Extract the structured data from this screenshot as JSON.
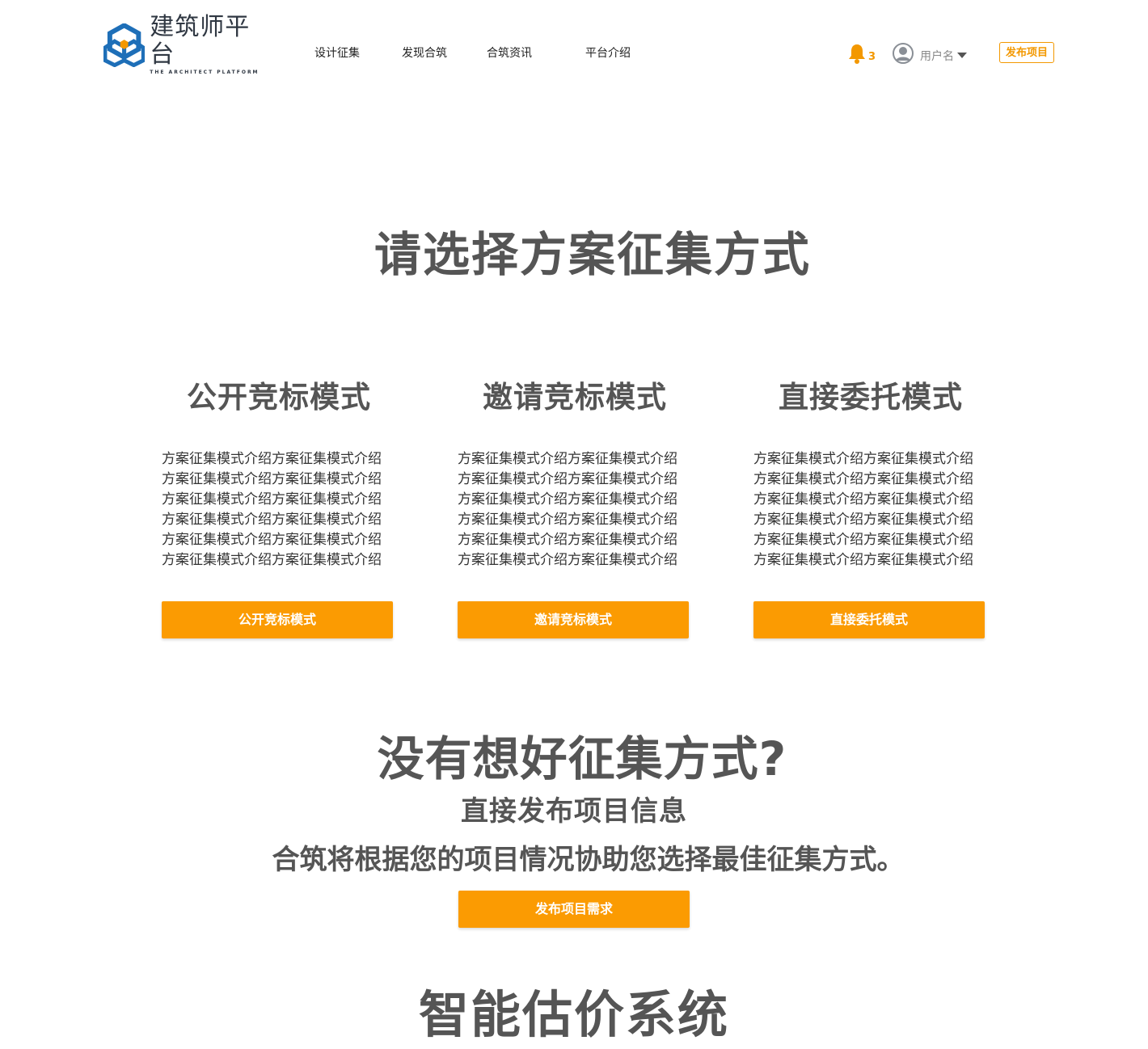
{
  "header": {
    "logo": {
      "text_cn": "建筑师平台",
      "text_en": "THE ARCHITECT PLATFORM"
    },
    "nav": [
      {
        "label": "设计征集"
      },
      {
        "label": "发现合筑"
      },
      {
        "label": "合筑资讯"
      },
      {
        "label": "平台介绍"
      }
    ],
    "notifications": {
      "icon": "bell-icon",
      "count": "3"
    },
    "user": {
      "icon": "avatar-icon",
      "name": "用户名"
    },
    "publish_label": "发布项目"
  },
  "main": {
    "title": "请选择方案征集方式",
    "modes": [
      {
        "title": "公开竞标模式",
        "desc_lines": [
          "方案征集模式介绍方案征集模式介绍",
          "方案征集模式介绍方案征集模式介绍",
          "方案征集模式介绍方案征集模式介绍",
          "方案征集模式介绍方案征集模式介绍",
          "方案征集模式介绍方案征集模式介绍",
          "方案征集模式介绍方案征集模式介绍"
        ],
        "button": "公开竞标模式"
      },
      {
        "title": "邀请竞标模式",
        "desc_lines": [
          "方案征集模式介绍方案征集模式介绍",
          "方案征集模式介绍方案征集模式介绍",
          "方案征集模式介绍方案征集模式介绍",
          "方案征集模式介绍方案征集模式介绍",
          "方案征集模式介绍方案征集模式介绍",
          "方案征集模式介绍方案征集模式介绍"
        ],
        "button": "邀请竞标模式"
      },
      {
        "title": "直接委托模式",
        "desc_lines": [
          "方案征集模式介绍方案征集模式介绍",
          "方案征集模式介绍方案征集模式介绍",
          "方案征集模式介绍方案征集模式介绍",
          "方案征集模式介绍方案征集模式介绍",
          "方案征集模式介绍方案征集模式介绍",
          "方案征集模式介绍方案征集模式介绍"
        ],
        "button": "直接委托模式"
      }
    ]
  },
  "undecided": {
    "title": "没有想好征集方式?",
    "subtitle": "直接发布项目信息",
    "subtitle2": "合筑将根据您的项目情况协助您选择最佳征集方式。",
    "button": "发布项目需求"
  },
  "estimate": {
    "title": "智能估价系统"
  },
  "colors": {
    "accent": "#fb9b02",
    "accent_text": "#f39800",
    "heading": "#555555",
    "logo_blue": "#1e6fb8",
    "logo_dark": "#2f3742"
  }
}
